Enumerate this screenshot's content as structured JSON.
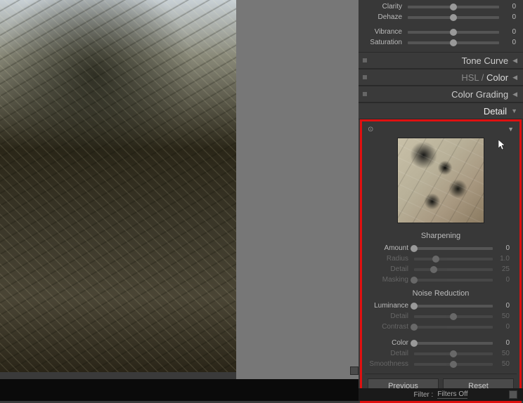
{
  "topSliders": {
    "clarity": {
      "label": "Clarity",
      "value": "0",
      "pos": 50
    },
    "dehaze": {
      "label": "Dehaze",
      "value": "0",
      "pos": 50
    },
    "vibrance": {
      "label": "Vibrance",
      "value": "0",
      "pos": 50
    },
    "saturation": {
      "label": "Saturation",
      "value": "0",
      "pos": 50
    }
  },
  "panels": {
    "toneCurve": "Tone Curve",
    "hslColor": {
      "hsl": "HSL",
      "sep": " / ",
      "color": "Color"
    },
    "colorGrading": "Color Grading",
    "detail": "Detail"
  },
  "sharpening": {
    "title": "Sharpening",
    "amount": {
      "label": "Amount",
      "value": "0",
      "pos": 0
    },
    "radius": {
      "label": "Radius",
      "value": "1.0",
      "pos": 28
    },
    "detail": {
      "label": "Detail",
      "value": "25",
      "pos": 25
    },
    "masking": {
      "label": "Masking",
      "value": "0",
      "pos": 0
    }
  },
  "noiseReduction": {
    "title": "Noise Reduction",
    "luminance": {
      "label": "Luminance",
      "value": "0",
      "pos": 0
    },
    "detail": {
      "label": "Detail",
      "value": "50",
      "pos": 50
    },
    "contrast": {
      "label": "Contrast",
      "value": "0",
      "pos": 0
    },
    "color": {
      "label": "Color",
      "value": "0",
      "pos": 0
    },
    "cdetail": {
      "label": "Detail",
      "value": "50",
      "pos": 50
    },
    "smoothness": {
      "label": "Smoothness",
      "value": "50",
      "pos": 50
    }
  },
  "buttons": {
    "previous": "Previous",
    "reset": "Reset"
  },
  "filterBar": {
    "label": "Filter :",
    "value": "Filters Off"
  }
}
